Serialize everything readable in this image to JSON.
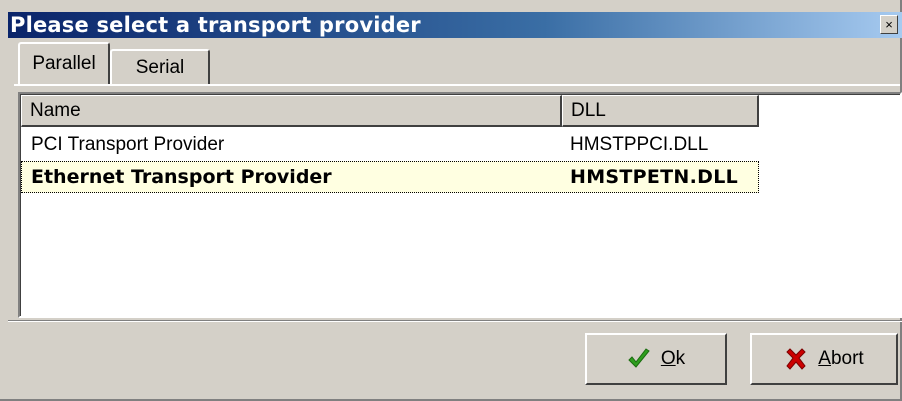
{
  "window": {
    "title": "Please select a transport provider",
    "close_glyph": "×"
  },
  "tabs": [
    {
      "label": "Parallel",
      "active": true
    },
    {
      "label": "Serial",
      "active": false
    }
  ],
  "list": {
    "columns": [
      "Name",
      "DLL"
    ],
    "rows": [
      {
        "name": "PCI Transport Provider",
        "dll": "HMSTPPCI.DLL",
        "selected": false
      },
      {
        "name": "Ethernet Transport Provider",
        "dll": "HMSTPETN.DLL",
        "selected": true
      }
    ]
  },
  "buttons": {
    "ok": {
      "mnemonic": "O",
      "rest": "k",
      "icon": "checkmark-icon",
      "icon_color": "#2e9e1e"
    },
    "abort": {
      "mnemonic": "A",
      "rest": "bort",
      "icon": "red-x-icon",
      "icon_color": "#cc0000"
    }
  }
}
